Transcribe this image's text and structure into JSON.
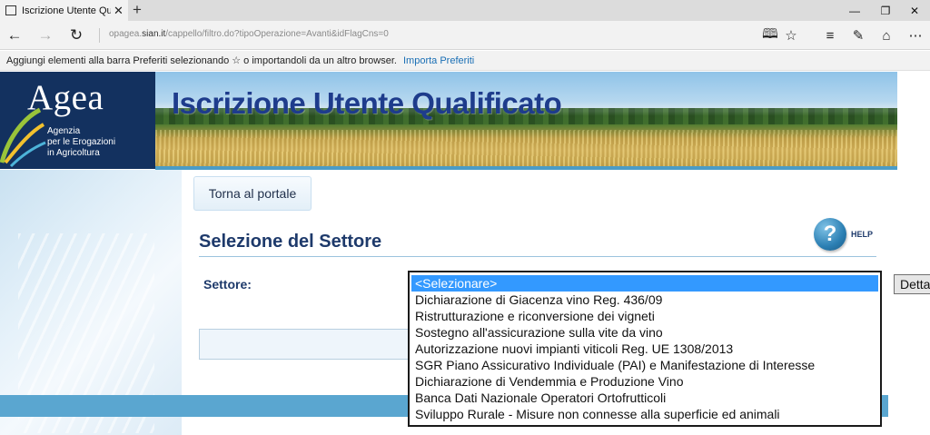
{
  "browser": {
    "tab_title": "Iscrizione Utente Qualifi",
    "tab_close": "✕",
    "new_tab": "+",
    "url_prefix": "opagea.",
    "url_domain": "sian.it",
    "url_path": "/cappello/filtro.do?tipoOperazione=Avanti&idFlagCns=0",
    "favorites_text": "Aggiungi elementi alla barra Preferiti selezionando ☆ o importandoli da un altro browser.",
    "favorites_link": "Importa Preferiti"
  },
  "header": {
    "logo_word": "Agea",
    "logo_line1": "Agenzia",
    "logo_line2": "per le Erogazioni",
    "logo_line3": "in Agricoltura",
    "banner_title": "Iscrizione Utente Qualificato"
  },
  "main": {
    "torna_label": "Torna al portale",
    "section_title": "Selezione del Settore",
    "help_symbol": "?",
    "help_label": "HELP",
    "settore_label": "Settore:",
    "detta_label": "Detta"
  },
  "dropdown": {
    "selected_index": 0,
    "options": [
      "<Selezionare>",
      "Dichiarazione di Giacenza vino Reg. 436/09",
      "Ristrutturazione e riconversione dei vigneti",
      "Sostegno all'assicurazione sulla vite da vino",
      "Autorizzazione nuovi impianti viticoli Reg. UE 1308/2013",
      "SGR Piano Assicurativo Individuale (PAI) e Manifestazione di Interesse",
      "Dichiarazione di Vendemmia e Produzione Vino",
      "Banca Dati Nazionale Operatori Ortofrutticoli",
      "Sviluppo Rurale - Misure non connesse alla superficie ed animali"
    ]
  },
  "colors": {
    "accent": "#1e3a6b",
    "selection": "#3399ff",
    "footer_bar": "#5aa6d0"
  }
}
